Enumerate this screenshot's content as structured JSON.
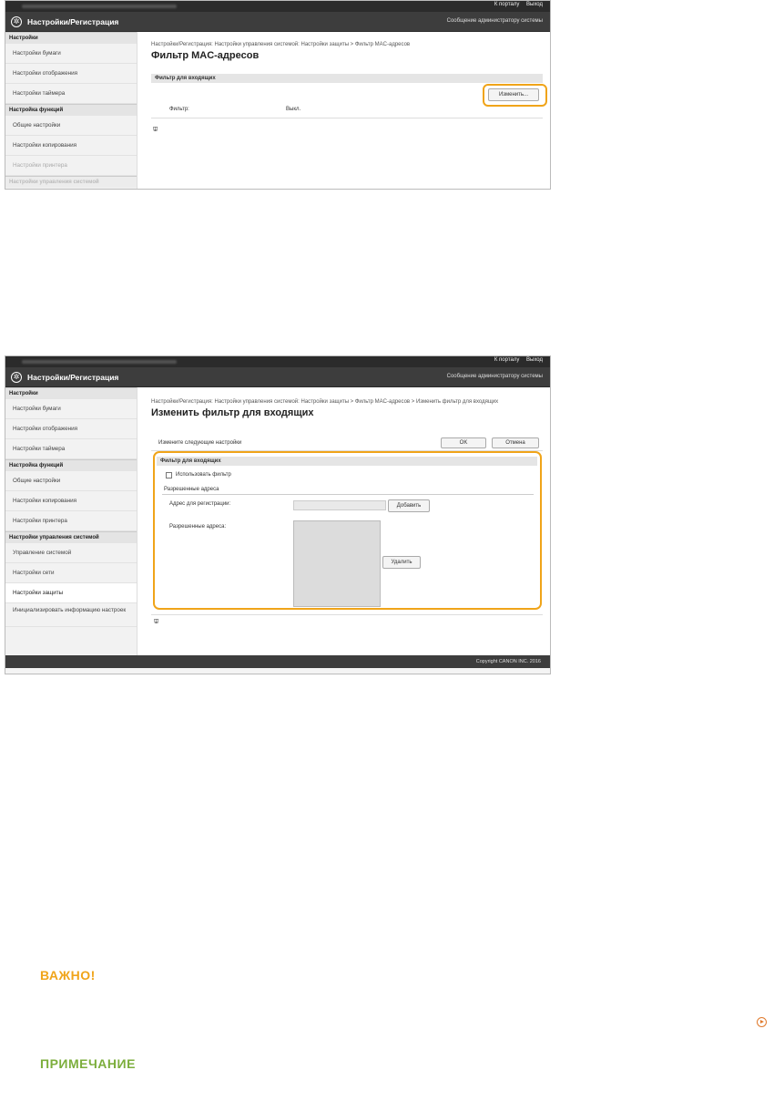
{
  "app": {
    "top_links": [
      "К порталу",
      "Выход"
    ],
    "title": "Настройки/Регистрация",
    "admin_message": "Сообщение администратору системы"
  },
  "sidebar1": {
    "sections": [
      {
        "title": "Настройки",
        "items": [
          "Настройки бумаги",
          "Настройки отображения",
          "Настройки таймера"
        ]
      },
      {
        "title": "Настройка функций",
        "items": [
          "Общие настройки",
          "Настройки копирования",
          "Настройки принтера"
        ]
      }
    ],
    "faded": "Настройки управления системой"
  },
  "screen1": {
    "breadcrumb": "Настройки/Регистрация: Настройки управления системой: Настройки защиты > Фильтр MAC-адресов",
    "page_title": "Фильтр MAC-адресов",
    "section_title": "Фильтр для входящих",
    "edit_button": "Изменить...",
    "filter_label": "Фильтр:",
    "filter_value": "Выкл.",
    "back_to_top": "⯶"
  },
  "sidebar2": {
    "sections": [
      {
        "title": "Настройки",
        "items": [
          "Настройки бумаги",
          "Настройки отображения",
          "Настройки таймера"
        ]
      },
      {
        "title": "Настройка функций",
        "items": [
          "Общие настройки",
          "Настройки копирования",
          "Настройки принтера"
        ]
      },
      {
        "title": "Настройки управления системой",
        "items": [
          "Управление системой",
          "Настройки сети",
          "Настройки защиты",
          "Инициализировать информацию настроек"
        ]
      }
    ]
  },
  "screen2": {
    "breadcrumb": "Настройки/Регистрация: Настройки управления системой: Настройки защиты > Фильтр MAC-адресов > Изменить фильтр для входящих",
    "page_title": "Изменить фильтр для входящих",
    "instruction": "Измените следующие настройки",
    "ok_button": "OK",
    "cancel_button": "Отмена",
    "section_title": "Фильтр для входящих",
    "use_filter_label": "Использовать фильтр",
    "allowed_header": "Разрешенные адреса",
    "register_label": "Адрес для регистрации:",
    "add_button": "Добавить",
    "allowed_label": "Разрешенные адреса:",
    "delete_button": "Удалить",
    "back_to_top": "⯶",
    "copyright": "Copyright CANON INC. 2016"
  },
  "doc": {
    "important_heading": "ВАЖНО!",
    "note_heading": "ПРИМЕЧАНИЕ"
  }
}
